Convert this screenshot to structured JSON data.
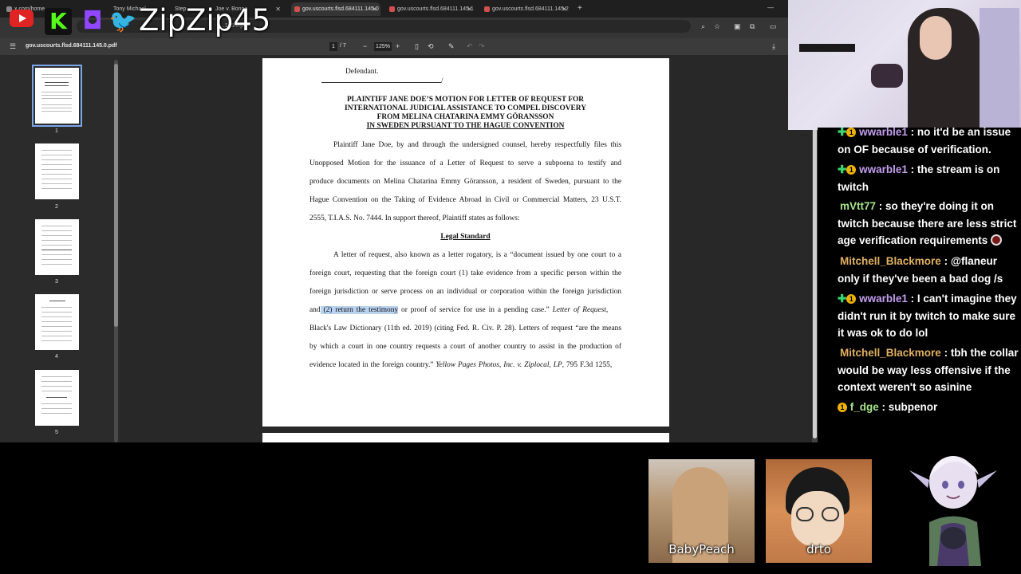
{
  "overlay": {
    "handle": "ZipZip45"
  },
  "browser": {
    "tabs": [
      {
        "label": "x.com/home"
      },
      {
        "label": "Tony Michael"
      },
      {
        "label": "Step"
      },
      {
        "label": "Joe v. Bonne"
      },
      {
        "label": "gov.uscourts.flsd.684111.145.0",
        "active": true
      },
      {
        "label": "gov.uscourts.flsd.684111.145.1"
      },
      {
        "label": "gov.uscourts.flsd.684111.145.2"
      }
    ],
    "url": "...145.0.pdf"
  },
  "pdf": {
    "filename": "gov.uscourts.flsd.684111.145.0.pdf",
    "page_current": "1",
    "page_total": "/ 7",
    "zoom": "125%",
    "thumbnails": [
      "1",
      "2",
      "3",
      "4",
      "5"
    ]
  },
  "document": {
    "defendant": "Defendant.",
    "title1": "PLAINTIFF JANE DOE’S MOTION FOR LETTER OF REQUEST FOR",
    "title2": "INTERNATIONAL JUDICIAL ASSISTANCE TO COMPEL DISCOVERY",
    "title3": "FROM MELINA CHATARINA EMMY GÖRANSSON",
    "title4": "IN SWEDEN PURSUANT TO THE HAGUE CONVENTION",
    "p1_l1": "Plaintiff Jane Doe, by and through the undersigned counsel, hereby respectfully files this",
    "p1_l2": "Unopposed Motion for the issuance of a Letter of Request to serve a subpoena to testify and",
    "p1_l3": "produce documents on Melina Chatarina Emmy Göransson, a resident of Sweden, pursuant to the",
    "p1_l4": "Hague Convention on the Taking of Evidence Abroad in Civil or Commercial Matters, 23 U.S.T.",
    "p1_l5": "2555, T.I.A.S. No. 7444. In support thereof, Plaintiff states as follows:",
    "heading": "Legal Standard",
    "p2_l1": "A letter of request, also known as a letter rogatory, is a “document issued by one court to a",
    "p2_l2": "foreign court, requesting that the foreign court (1) take evidence from a specific person within the",
    "p2_l3": "foreign jurisdiction or serve process on an individual or corporation within the foreign jurisdiction",
    "p2_l4_a": "and",
    "p2_l4_hl": " (2) return the testimony",
    "p2_l4_b": " or proof of service for use in a pending case.” ",
    "p2_l4_i": "Letter of Request",
    "p2_l4_c": ",",
    "p2_l5": "Black's Law Dictionary (11th ed. 2019) (citing Fed. R. Civ. P. 28). Letters of request “are the means",
    "p2_l6": "by which a court in one country requests a court of another country to assist in the production of",
    "p2_l7_a": "evidence located in the foreign country.” ",
    "p2_l7_i": "Yellow Pages Photos, Inc. v. Ziplocal, LP",
    "p2_l7_b": ", 795 F.3d 1255,"
  },
  "chat": [
    {
      "badges": "green+gold",
      "user": "wwarble1",
      "user_color": "#c49ef0",
      "text": "no it'd be an issue on OF because of verification."
    },
    {
      "badges": "green+gold",
      "user": "wwarble1",
      "user_color": "#c49ef0",
      "text": "the stream is on twitch"
    },
    {
      "badges": "",
      "user": "mVtt77",
      "user_color": "#a6e28c",
      "text": "so they're doing it on twitch because there are less strict age verification requirements"
    },
    {
      "badges": "",
      "user": "Mitchell_Blackmore",
      "user_color": "#e0b060",
      "text": "@flaneur only if they've been a bad dog /s"
    },
    {
      "badges": "green+gold",
      "user": "wwarble1",
      "user_color": "#c49ef0",
      "text": "I can't imagine they didn't run it by twitch to make sure it was ok to do lol"
    },
    {
      "badges": "",
      "user": "Mitchell_Blackmore",
      "user_color": "#e0b060",
      "text": "tbh the collar would be way less offensive if the context weren't so asinine"
    },
    {
      "badges": "gold",
      "user": "f_dge",
      "user_color": "#a6e28c",
      "text": "subpenor"
    }
  ],
  "cams": {
    "left_label": "BabyPeach",
    "right_label": "drto"
  }
}
